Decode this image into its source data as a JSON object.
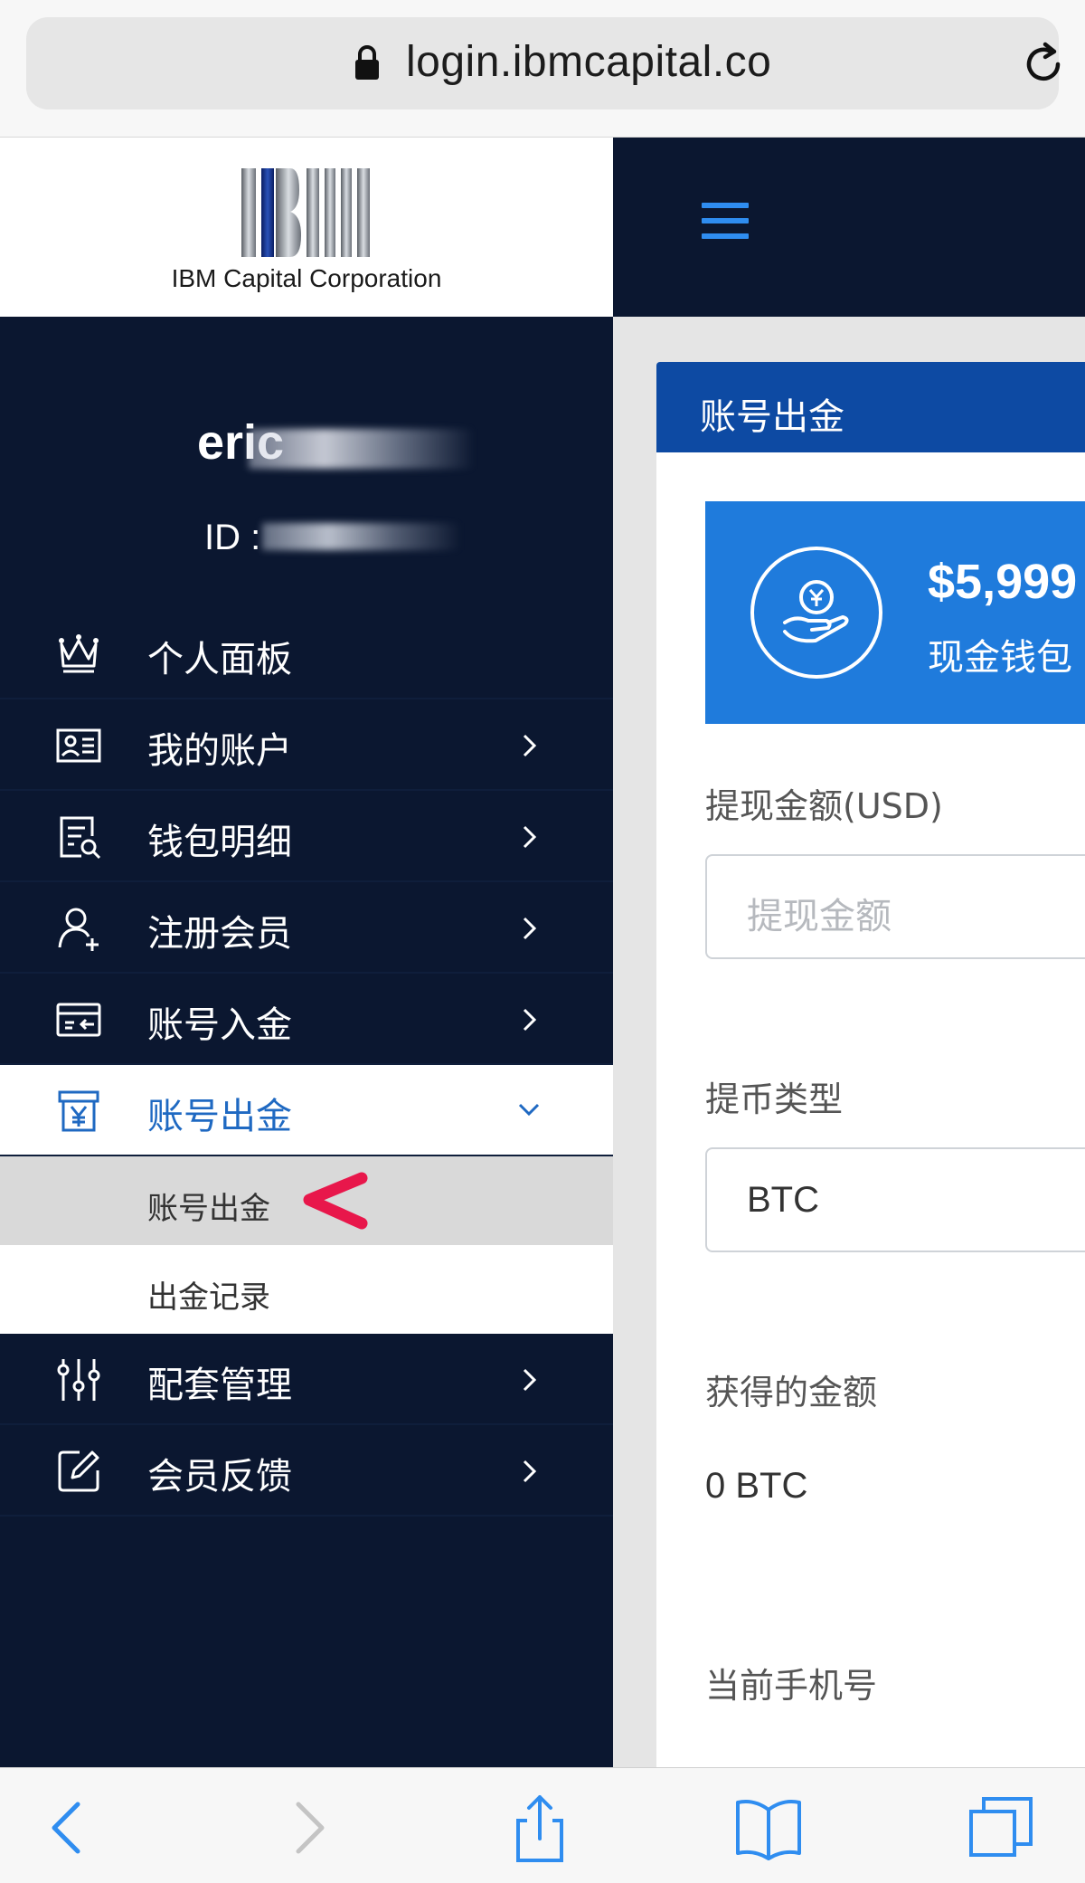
{
  "browser": {
    "url": "login.ibmcapital.co"
  },
  "brand": {
    "company_name": "IBM Capital Corporation",
    "logo_letters": "IBM"
  },
  "user": {
    "name_visible": "eric",
    "id_prefix": "ID :"
  },
  "sidebar": {
    "items": [
      {
        "label": "个人面板",
        "icon": "crown-icon",
        "has_chevron": false
      },
      {
        "label": "我的账户",
        "icon": "id-card-icon",
        "has_chevron": true
      },
      {
        "label": "钱包明细",
        "icon": "ledger-search-icon",
        "has_chevron": true
      },
      {
        "label": "注册会员",
        "icon": "user-add-icon",
        "has_chevron": true
      },
      {
        "label": "账号入金",
        "icon": "card-deposit-icon",
        "has_chevron": true
      },
      {
        "label": "账号出金",
        "icon": "yen-box-icon",
        "has_chevron": true,
        "expanded": true
      }
    ],
    "sub_items": [
      {
        "label": "账号出金",
        "current": true
      },
      {
        "label": "出金记录",
        "current": false
      }
    ],
    "items_after": [
      {
        "label": "配套管理",
        "icon": "sliders-icon",
        "has_chevron": true
      },
      {
        "label": "会员反馈",
        "icon": "edit-icon",
        "has_chevron": true
      }
    ]
  },
  "main": {
    "panel_title": "账号出金",
    "wallet": {
      "amount": "$5,999",
      "label": "现金钱包"
    },
    "form": {
      "amount_label": "提现金额(USD)",
      "amount_placeholder": "提现金额",
      "coin_type_label": "提币类型",
      "coin_type_value": "BTC",
      "received_label": "获得的金额",
      "received_value": "0 BTC",
      "phone_label": "当前手机号"
    }
  },
  "colors": {
    "sidebar_bg": "#0b1730",
    "panel_header": "#0d4aa3",
    "wallet_card": "#1f7bdc",
    "active_text": "#1f69c2",
    "arrow_red": "#e8174b",
    "browser_blue": "#2f8df0"
  }
}
